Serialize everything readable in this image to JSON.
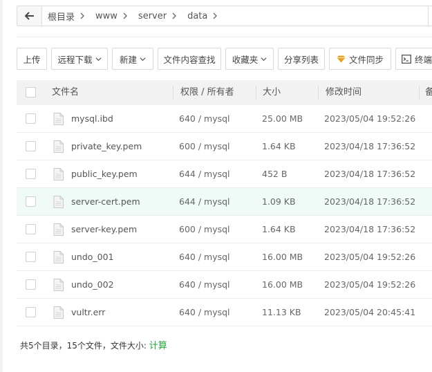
{
  "breadcrumb": {
    "items": [
      "根目录",
      "www",
      "server",
      "data"
    ]
  },
  "toolbar": {
    "upload": "上传",
    "remote_download": "远程下载",
    "new": "新建",
    "content_search": "文件内容查找",
    "favorites": "收藏夹",
    "share_list": "分享列表",
    "file_sync": "文件同步",
    "terminal": "终端"
  },
  "table": {
    "headers": {
      "name": "文件名",
      "perm": "权限 / 所有者",
      "size": "大小",
      "mtime": "修改时间",
      "note": "备"
    },
    "rows": [
      {
        "name": "mysql.ibd",
        "perm": "640 / mysql",
        "size": "25.00 MB",
        "mtime": "2023/05/04 19:52:26"
      },
      {
        "name": "private_key.pem",
        "perm": "600 / mysql",
        "size": "1.64 KB",
        "mtime": "2023/04/18 17:36:52"
      },
      {
        "name": "public_key.pem",
        "perm": "644 / mysql",
        "size": "452 B",
        "mtime": "2023/04/18 17:36:52"
      },
      {
        "name": "server-cert.pem",
        "perm": "644 / mysql",
        "size": "1.09 KB",
        "mtime": "2023/04/18 17:36:52"
      },
      {
        "name": "server-key.pem",
        "perm": "600 / mysql",
        "size": "1.64 KB",
        "mtime": "2023/04/18 17:36:52"
      },
      {
        "name": "undo_001",
        "perm": "640 / mysql",
        "size": "16.00 MB",
        "mtime": "2023/05/04 19:52:26"
      },
      {
        "name": "undo_002",
        "perm": "640 / mysql",
        "size": "16.00 MB",
        "mtime": "2023/05/04 19:52:26"
      },
      {
        "name": "vultr.err",
        "perm": "640 / mysql",
        "size": "11.13 KB",
        "mtime": "2023/05/04 20:45:41"
      }
    ]
  },
  "footer": {
    "summary": "共5个目录，15个文件，文件大小: ",
    "calc_label": "计算"
  },
  "colors": {
    "accent_green": "#20a53a",
    "row_highlight": "#f0faf6",
    "header_bg": "#f2f2f2"
  }
}
